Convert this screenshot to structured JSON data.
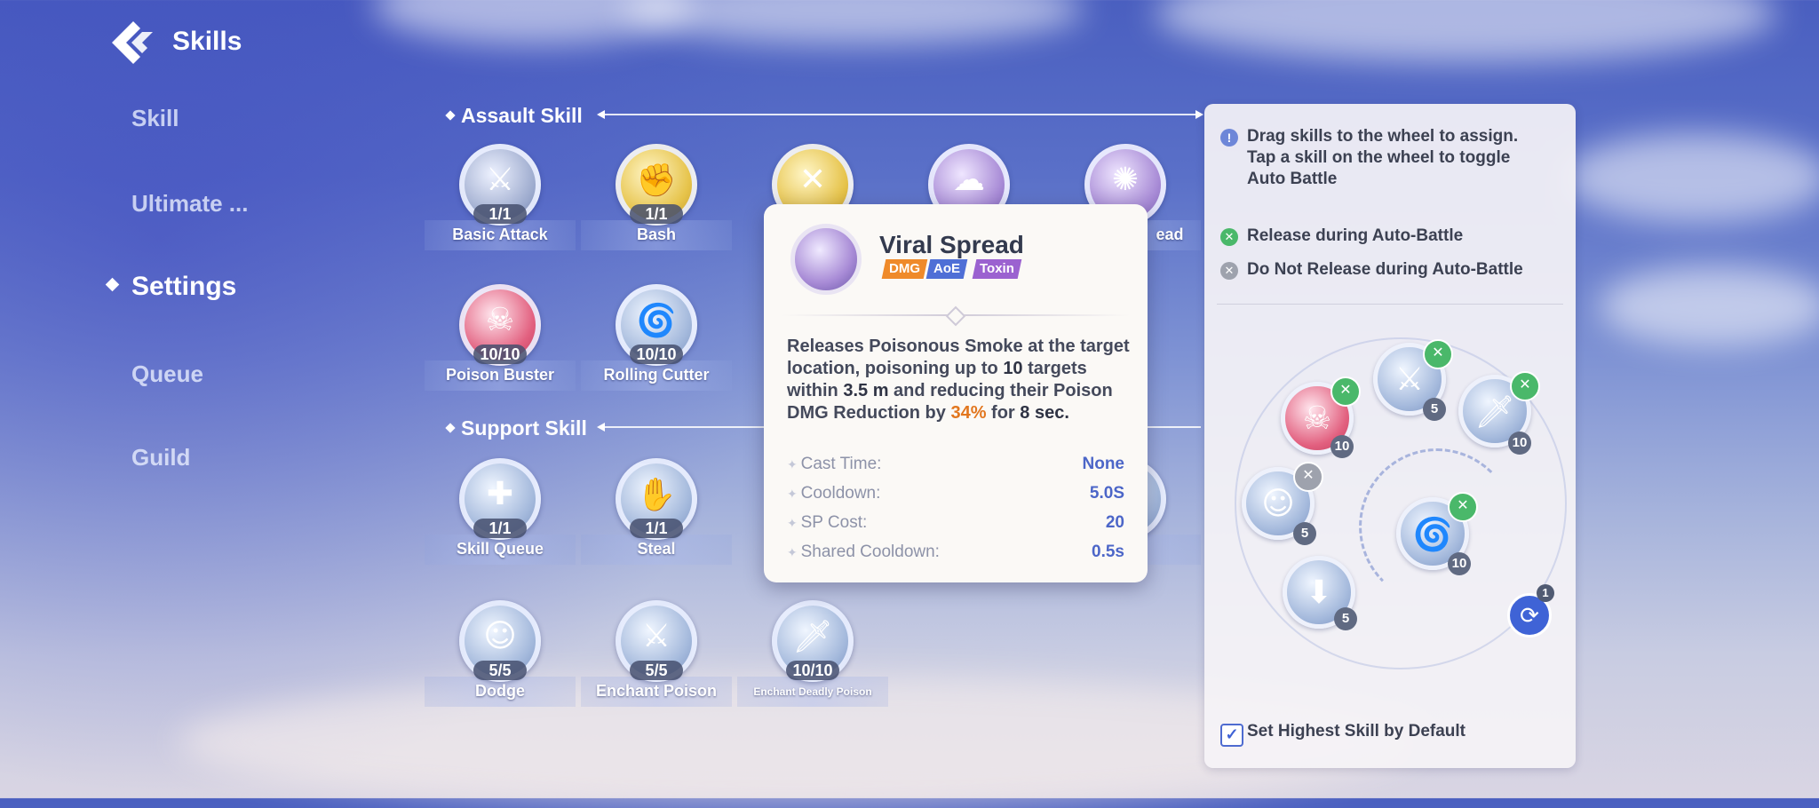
{
  "header": {
    "title": "Skills",
    "logo_icon": "chevron-logo-icon"
  },
  "nav": {
    "items": [
      {
        "label": "Skill",
        "active": false
      },
      {
        "label": "Ultimate ...",
        "active": false
      },
      {
        "label": "Settings",
        "active": true
      },
      {
        "label": "Queue",
        "active": false
      },
      {
        "label": "Guild",
        "active": false
      }
    ]
  },
  "sections": {
    "assault": "Assault Skill",
    "support": "Support Skill"
  },
  "assault_skills": [
    {
      "name": "Basic Attack",
      "level": "1/1",
      "color": "silver",
      "icon": "sword-icon"
    },
    {
      "name": "Bash",
      "level": "1/1",
      "color": "gold",
      "icon": "bash-icon"
    },
    {
      "name": "",
      "level": "",
      "color": "gold",
      "icon": "cross-slash-icon"
    },
    {
      "name": "",
      "level": "",
      "color": "purple",
      "icon": "smoke-icon"
    },
    {
      "name": "ead",
      "level": "",
      "color": "purple",
      "icon": "virus-icon"
    },
    {
      "name": "Poison Buster",
      "level": "10/10",
      "color": "pink",
      "icon": "skull-icon"
    },
    {
      "name": "Rolling Cutter",
      "level": "10/10",
      "color": "blue",
      "icon": "tornado-icon"
    }
  ],
  "support_skills": [
    {
      "name": "Skill Queue",
      "level": "1/1",
      "color": "blue",
      "icon": "queue-icon"
    },
    {
      "name": "Steal",
      "level": "1/1",
      "color": "blue",
      "icon": "steal-icon"
    },
    {
      "name": "Dodge",
      "level": "5/5",
      "color": "blue",
      "icon": "dodge-icon"
    },
    {
      "name": "Enchant Poison",
      "level": "5/5",
      "color": "blue",
      "icon": "enchant-icon"
    },
    {
      "name": "Enchant Deadly Poison",
      "level": "10/10",
      "color": "blue",
      "icon": "deadly-enchant-icon"
    }
  ],
  "tooltip": {
    "title": "Viral Spread",
    "tags": [
      "DMG",
      "AoE",
      "Toxin"
    ],
    "tag_colors": [
      "#ef8a2a",
      "#4f6fd6",
      "#9b62d0"
    ],
    "desc_part1": "Releases Poisonous Smoke at the target location, poisoning up to ",
    "desc_targets": "10",
    "desc_part2": " targets within ",
    "desc_range": "3.5 m",
    "desc_part3": " and reducing their Poison DMG Reduction by ",
    "desc_pct": "34%",
    "desc_part4": " for ",
    "desc_dur": "8 sec.",
    "stats": [
      {
        "label": "Cast Time:",
        "value": "None"
      },
      {
        "label": "Cooldown:",
        "value": "5.0S"
      },
      {
        "label": "SP Cost:",
        "value": "20"
      },
      {
        "label": "Shared Cooldown:",
        "value": "0.5s"
      }
    ]
  },
  "panel": {
    "info_line1": "Drag skills to the wheel to assign.",
    "info_line2": "Tap a skill on the wheel to toggle",
    "info_line3": "Auto Battle",
    "release_label": "Release during Auto-Battle",
    "no_release_label": "Do Not Release during Auto-Battle",
    "default_label": "Set Highest Skill by Default",
    "default_checked": true,
    "cycle_count": "1"
  },
  "wheel": [
    {
      "icon": "skull-icon",
      "num": "10",
      "badge": "release",
      "color": "pink"
    },
    {
      "icon": "sword-icon",
      "num": "5",
      "badge": "release",
      "color": "blue"
    },
    {
      "icon": "blade-icon",
      "num": "10",
      "badge": "release",
      "color": "blue"
    },
    {
      "icon": "dodge-icon",
      "num": "5",
      "badge": "no-release",
      "color": "blue"
    },
    {
      "icon": "tornado-icon",
      "num": "10",
      "badge": "release",
      "color": "blue"
    },
    {
      "icon": "down-arrow-icon",
      "num": "5",
      "badge": "none",
      "color": "blue"
    }
  ]
}
